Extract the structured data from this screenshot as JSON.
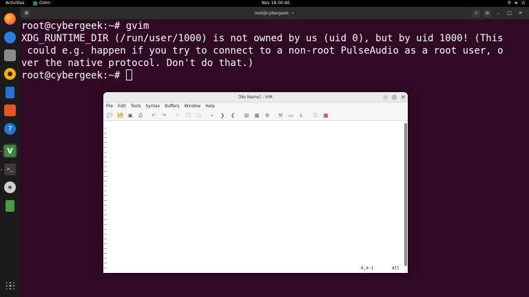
{
  "topbar": {
    "activities": "Activities",
    "app_name": "GVim",
    "clock": "Nov 18  00:40",
    "sys_icons": [
      "network-icon",
      "volume-icon",
      "power-icon"
    ]
  },
  "dock": {
    "items": [
      {
        "name": "firefox-icon",
        "color": "#ff7139"
      },
      {
        "name": "thunderbird-icon",
        "color": "#2a7de1"
      },
      {
        "name": "files-icon",
        "color": "#8a8a8a"
      },
      {
        "name": "rhythmbox-icon",
        "color": "#f5b400"
      },
      {
        "name": "writer-icon",
        "color": "#2b6fd6"
      },
      {
        "name": "software-icon",
        "color": "#e95420"
      },
      {
        "name": "help-icon",
        "color": "#1f76d2"
      },
      {
        "name": "gvim-icon",
        "color": "#3a8a3a"
      },
      {
        "name": "terminal-icon",
        "color": "#3b3b3b"
      },
      {
        "name": "dvd-icon",
        "color": "#cfcfcf"
      },
      {
        "name": "trash-icon",
        "color": "#4a9a4a"
      }
    ],
    "apps_grid": "show-apps-icon"
  },
  "terminal": {
    "title": "root@cybergeek: ~",
    "lines": [
      "root@cybergeek:~# gvim",
      "XDG_RUNTIME_DIR (/run/user/1000) is not owned by us (uid 0), but by uid 1000! (This",
      " could e.g. happen if you try to connect to a non-root PulseAudio as a root user, o",
      "ver the native protocol. Don't do that.)",
      "root@cybergeek:~# "
    ]
  },
  "gvim": {
    "title": "[No Name] - VIM",
    "menu": [
      "File",
      "Edit",
      "Tools",
      "Syntax",
      "Buffers",
      "Window",
      "Help"
    ],
    "tilde": "~",
    "tilde_count": 30,
    "position": "0,0-1",
    "scroll": "All"
  },
  "colors": {
    "terminal_bg": "#300a24",
    "dock_bg": "#1b1b1b",
    "vim_tilde": "#1e6fd8"
  }
}
